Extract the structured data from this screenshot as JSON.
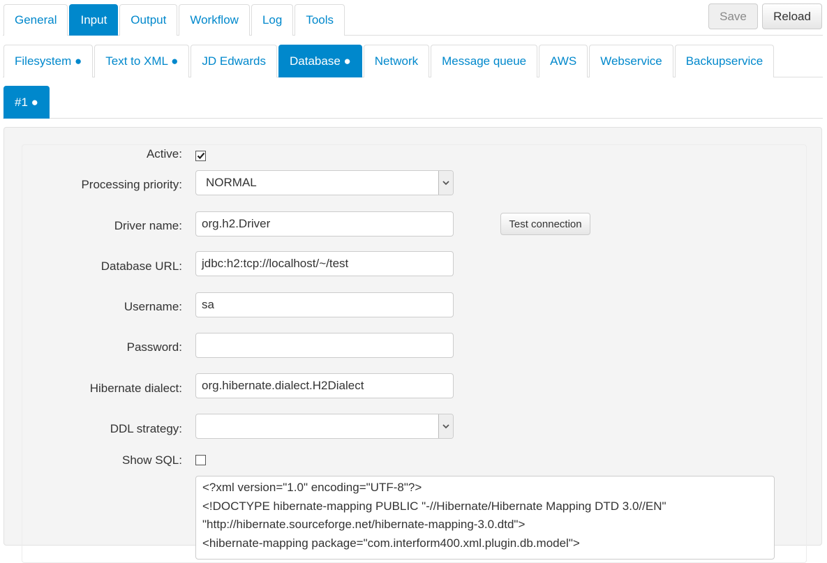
{
  "main_tabs": [
    {
      "label": "General",
      "active": false
    },
    {
      "label": "Input",
      "active": true
    },
    {
      "label": "Output",
      "active": false
    },
    {
      "label": "Workflow",
      "active": false
    },
    {
      "label": "Log",
      "active": false
    },
    {
      "label": "Tools",
      "active": false
    }
  ],
  "toolbar": {
    "save_label": "Save",
    "save_disabled": true,
    "reload_label": "Reload"
  },
  "input_tabs": [
    {
      "label": "Filesystem ●",
      "active": false
    },
    {
      "label": "Text to XML ●",
      "active": false
    },
    {
      "label": "JD Edwards",
      "active": false
    },
    {
      "label": "Database ●",
      "active": true
    },
    {
      "label": "Network",
      "active": false
    },
    {
      "label": "Message queue",
      "active": false
    },
    {
      "label": "AWS",
      "active": false
    },
    {
      "label": "Webservice",
      "active": false
    },
    {
      "label": "Backupservice",
      "active": false
    }
  ],
  "instance_tabs": [
    {
      "label": "#1 ●",
      "active": true
    }
  ],
  "form": {
    "active": {
      "label": "Active:",
      "checked": true
    },
    "priority": {
      "label": "Processing priority:",
      "value": "NORMAL"
    },
    "driver": {
      "label": "Driver name:",
      "value": "org.h2.Driver"
    },
    "test_connection_label": "Test connection",
    "url": {
      "label": "Database URL:",
      "value": "jdbc:h2:tcp://localhost/~/test"
    },
    "username": {
      "label": "Username:",
      "value": "sa"
    },
    "password": {
      "label": "Password:",
      "value": ""
    },
    "dialect": {
      "label": "Hibernate dialect:",
      "value": "org.hibernate.dialect.H2Dialect"
    },
    "ddl": {
      "label": "DDL strategy:",
      "value": ""
    },
    "show_sql": {
      "label": "Show SQL:",
      "checked": false
    },
    "mapping_xml": "<?xml version=\"1.0\" encoding=\"UTF-8\"?>\n<!DOCTYPE hibernate-mapping PUBLIC \"-//Hibernate/Hibernate Mapping DTD 3.0//EN\"\n\"http://hibernate.sourceforge.net/hibernate-mapping-3.0.dtd\">\n<hibernate-mapping package=\"com.interform400.xml.plugin.db.model\">"
  },
  "colors": {
    "accent": "#0088cc",
    "panel_bg": "#f4f4f4"
  }
}
